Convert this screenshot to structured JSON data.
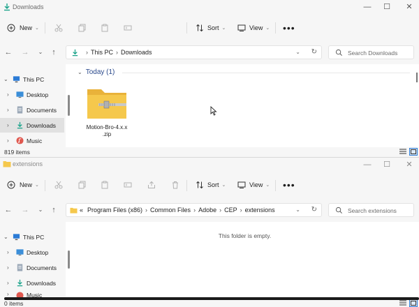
{
  "window1": {
    "title": "Downloads",
    "toolbar": {
      "new_label": "New",
      "sort_label": "Sort",
      "view_label": "View"
    },
    "breadcrumb": [
      "This PC",
      "Downloads"
    ],
    "search_placeholder": "Search Downloads",
    "nav": [
      {
        "label": "This PC"
      },
      {
        "label": "Desktop"
      },
      {
        "label": "Documents"
      },
      {
        "label": "Downloads"
      },
      {
        "label": "Music"
      }
    ],
    "group_header": "Today (1)",
    "files": [
      {
        "name_line1": "Motion-Bro-4.x.x",
        "name_line2": ".zip"
      }
    ],
    "status": "819 items"
  },
  "window2": {
    "title": "extensions",
    "toolbar": {
      "new_label": "New",
      "sort_label": "Sort",
      "view_label": "View"
    },
    "breadcrumb_prefix": "«",
    "breadcrumb": [
      "Program Files (x86)",
      "Common Files",
      "Adobe",
      "CEP",
      "extensions"
    ],
    "search_placeholder": "Search extensions",
    "nav": [
      {
        "label": "This PC"
      },
      {
        "label": "Desktop"
      },
      {
        "label": "Documents"
      },
      {
        "label": "Downloads"
      },
      {
        "label": "Music"
      }
    ],
    "empty_message": "This folder is empty.",
    "status": "0 items"
  },
  "colors": {
    "folder_yellow": "#f5c84c",
    "accent": "#2b7bd6",
    "download_green": "#1aa38a"
  }
}
